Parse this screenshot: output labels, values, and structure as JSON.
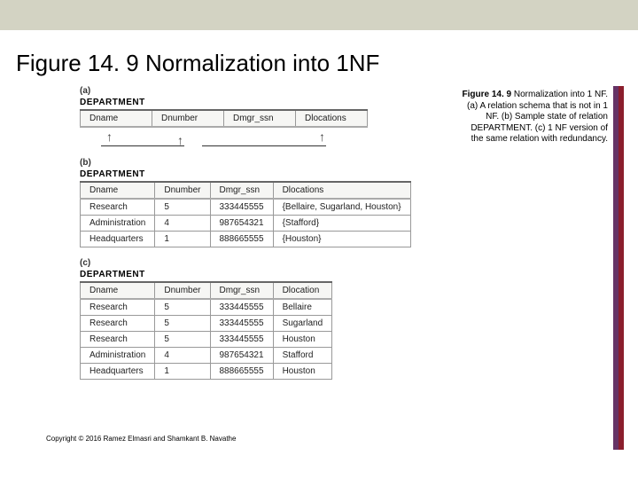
{
  "slide": {
    "title": "Figure 14. 9 Normalization into 1NF",
    "footer": "Copyright © 2016 Ramez Elmasri and Shamkant B. Navathe"
  },
  "caption": {
    "title": "Figure 14. 9",
    "body": "Normalization into 1 NF. (a) A relation schema that is not in 1 NF. (b) Sample state of relation DEPARTMENT. (c) 1 NF version of the same relation with redundancy."
  },
  "partA": {
    "label": "(a)",
    "relation": "DEPARTMENT",
    "cols": [
      "Dname",
      "Dnumber",
      "Dmgr_ssn",
      "Dlocations"
    ]
  },
  "partB": {
    "label": "(b)",
    "relation": "DEPARTMENT",
    "cols": [
      "Dname",
      "Dnumber",
      "Dmgr_ssn",
      "Dlocations"
    ],
    "rows": [
      [
        "Research",
        "5",
        "333445555",
        "{Bellaire, Sugarland, Houston}"
      ],
      [
        "Administration",
        "4",
        "987654321",
        "{Stafford}"
      ],
      [
        "Headquarters",
        "1",
        "888665555",
        "{Houston}"
      ]
    ]
  },
  "partC": {
    "label": "(c)",
    "relation": "DEPARTMENT",
    "cols": [
      "Dname",
      "Dnumber",
      "Dmgr_ssn",
      "Dlocation"
    ],
    "rows": [
      [
        "Research",
        "5",
        "333445555",
        "Bellaire"
      ],
      [
        "Research",
        "5",
        "333445555",
        "Sugarland"
      ],
      [
        "Research",
        "5",
        "333445555",
        "Houston"
      ],
      [
        "Administration",
        "4",
        "987654321",
        "Stafford"
      ],
      [
        "Headquarters",
        "1",
        "888665555",
        "Houston"
      ]
    ]
  }
}
